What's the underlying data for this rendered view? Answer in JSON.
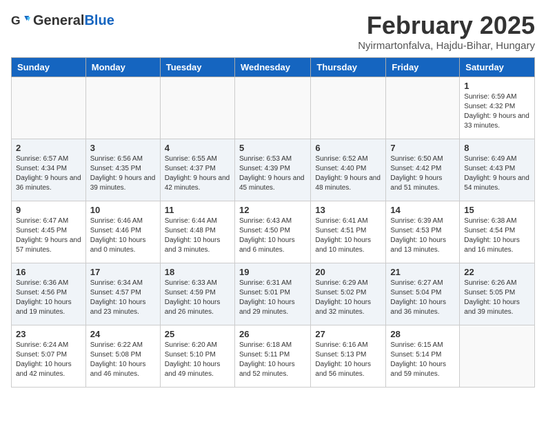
{
  "header": {
    "logo_general": "General",
    "logo_blue": "Blue",
    "month_title": "February 2025",
    "location": "Nyirmartonfalva, Hajdu-Bihar, Hungary"
  },
  "days_of_week": [
    "Sunday",
    "Monday",
    "Tuesday",
    "Wednesday",
    "Thursday",
    "Friday",
    "Saturday"
  ],
  "weeks": [
    [
      {
        "day": "",
        "info": ""
      },
      {
        "day": "",
        "info": ""
      },
      {
        "day": "",
        "info": ""
      },
      {
        "day": "",
        "info": ""
      },
      {
        "day": "",
        "info": ""
      },
      {
        "day": "",
        "info": ""
      },
      {
        "day": "1",
        "info": "Sunrise: 6:59 AM\nSunset: 4:32 PM\nDaylight: 9 hours and 33 minutes."
      }
    ],
    [
      {
        "day": "2",
        "info": "Sunrise: 6:57 AM\nSunset: 4:34 PM\nDaylight: 9 hours and 36 minutes."
      },
      {
        "day": "3",
        "info": "Sunrise: 6:56 AM\nSunset: 4:35 PM\nDaylight: 9 hours and 39 minutes."
      },
      {
        "day": "4",
        "info": "Sunrise: 6:55 AM\nSunset: 4:37 PM\nDaylight: 9 hours and 42 minutes."
      },
      {
        "day": "5",
        "info": "Sunrise: 6:53 AM\nSunset: 4:39 PM\nDaylight: 9 hours and 45 minutes."
      },
      {
        "day": "6",
        "info": "Sunrise: 6:52 AM\nSunset: 4:40 PM\nDaylight: 9 hours and 48 minutes."
      },
      {
        "day": "7",
        "info": "Sunrise: 6:50 AM\nSunset: 4:42 PM\nDaylight: 9 hours and 51 minutes."
      },
      {
        "day": "8",
        "info": "Sunrise: 6:49 AM\nSunset: 4:43 PM\nDaylight: 9 hours and 54 minutes."
      }
    ],
    [
      {
        "day": "9",
        "info": "Sunrise: 6:47 AM\nSunset: 4:45 PM\nDaylight: 9 hours and 57 minutes."
      },
      {
        "day": "10",
        "info": "Sunrise: 6:46 AM\nSunset: 4:46 PM\nDaylight: 10 hours and 0 minutes."
      },
      {
        "day": "11",
        "info": "Sunrise: 6:44 AM\nSunset: 4:48 PM\nDaylight: 10 hours and 3 minutes."
      },
      {
        "day": "12",
        "info": "Sunrise: 6:43 AM\nSunset: 4:50 PM\nDaylight: 10 hours and 6 minutes."
      },
      {
        "day": "13",
        "info": "Sunrise: 6:41 AM\nSunset: 4:51 PM\nDaylight: 10 hours and 10 minutes."
      },
      {
        "day": "14",
        "info": "Sunrise: 6:39 AM\nSunset: 4:53 PM\nDaylight: 10 hours and 13 minutes."
      },
      {
        "day": "15",
        "info": "Sunrise: 6:38 AM\nSunset: 4:54 PM\nDaylight: 10 hours and 16 minutes."
      }
    ],
    [
      {
        "day": "16",
        "info": "Sunrise: 6:36 AM\nSunset: 4:56 PM\nDaylight: 10 hours and 19 minutes."
      },
      {
        "day": "17",
        "info": "Sunrise: 6:34 AM\nSunset: 4:57 PM\nDaylight: 10 hours and 23 minutes."
      },
      {
        "day": "18",
        "info": "Sunrise: 6:33 AM\nSunset: 4:59 PM\nDaylight: 10 hours and 26 minutes."
      },
      {
        "day": "19",
        "info": "Sunrise: 6:31 AM\nSunset: 5:01 PM\nDaylight: 10 hours and 29 minutes."
      },
      {
        "day": "20",
        "info": "Sunrise: 6:29 AM\nSunset: 5:02 PM\nDaylight: 10 hours and 32 minutes."
      },
      {
        "day": "21",
        "info": "Sunrise: 6:27 AM\nSunset: 5:04 PM\nDaylight: 10 hours and 36 minutes."
      },
      {
        "day": "22",
        "info": "Sunrise: 6:26 AM\nSunset: 5:05 PM\nDaylight: 10 hours and 39 minutes."
      }
    ],
    [
      {
        "day": "23",
        "info": "Sunrise: 6:24 AM\nSunset: 5:07 PM\nDaylight: 10 hours and 42 minutes."
      },
      {
        "day": "24",
        "info": "Sunrise: 6:22 AM\nSunset: 5:08 PM\nDaylight: 10 hours and 46 minutes."
      },
      {
        "day": "25",
        "info": "Sunrise: 6:20 AM\nSunset: 5:10 PM\nDaylight: 10 hours and 49 minutes."
      },
      {
        "day": "26",
        "info": "Sunrise: 6:18 AM\nSunset: 5:11 PM\nDaylight: 10 hours and 52 minutes."
      },
      {
        "day": "27",
        "info": "Sunrise: 6:16 AM\nSunset: 5:13 PM\nDaylight: 10 hours and 56 minutes."
      },
      {
        "day": "28",
        "info": "Sunrise: 6:15 AM\nSunset: 5:14 PM\nDaylight: 10 hours and 59 minutes."
      },
      {
        "day": "",
        "info": ""
      }
    ]
  ]
}
